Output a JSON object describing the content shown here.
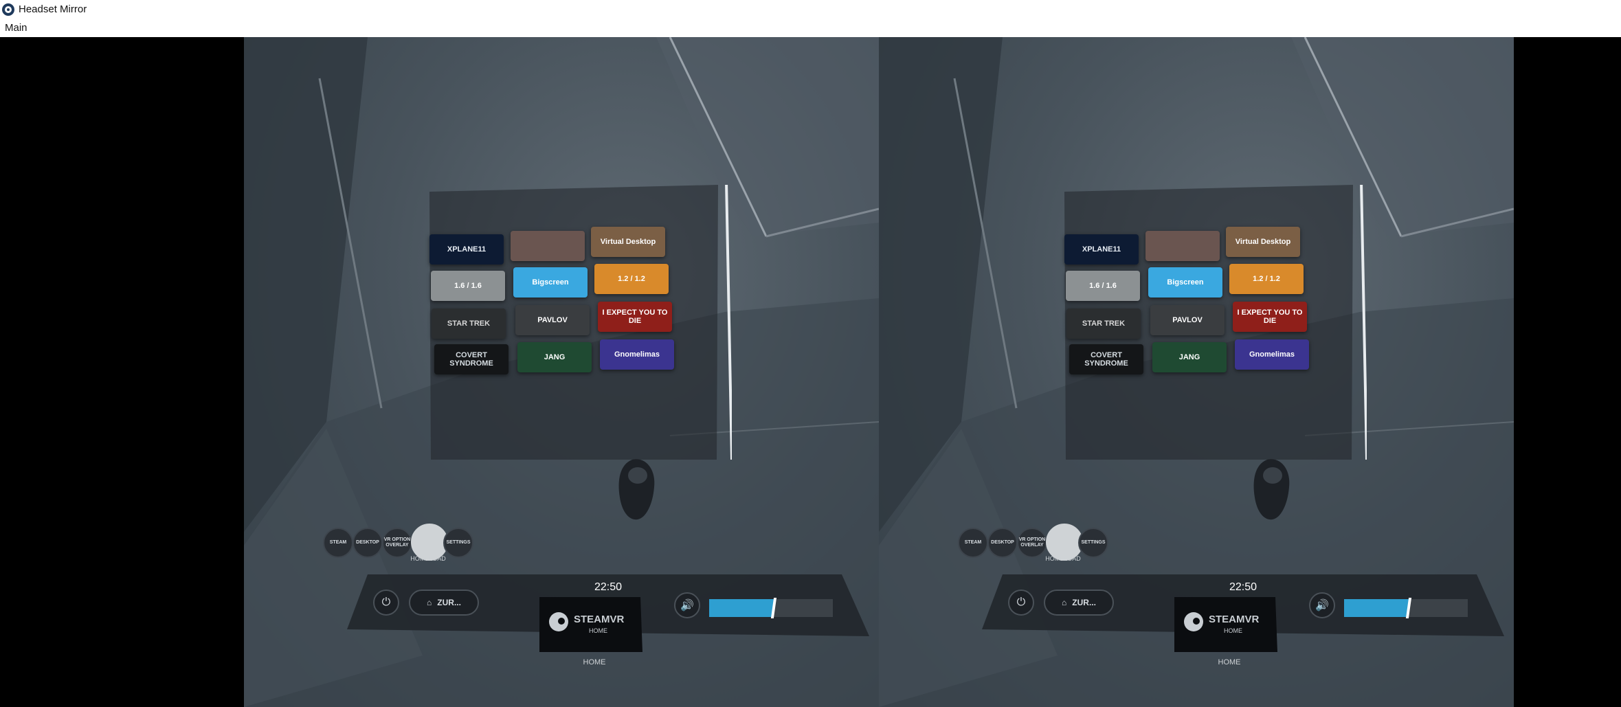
{
  "window": {
    "title": "Headset Mirror",
    "icon": "steamvr-icon"
  },
  "menu": {
    "items": [
      {
        "label": "Main"
      }
    ]
  },
  "vr_view": {
    "tiles": [
      {
        "label": "XPLANE11",
        "bg": "#0d1b33",
        "fg": "#e8eef5"
      },
      {
        "label": "",
        "bg": "#6a5550",
        "fg": "#ffffff"
      },
      {
        "label": "Virtual Desktop",
        "bg": "#7b5f45",
        "fg": "#ffffff"
      },
      {
        "label": "1.6 / 1.6",
        "bg": "#8c9193",
        "fg": "#ffffff"
      },
      {
        "label": "Bigscreen",
        "bg": "#3aa8e0",
        "fg": "#ffffff"
      },
      {
        "label": "1.2 / 1.2",
        "bg": "#d98a2b",
        "fg": "#ffffff"
      },
      {
        "label": "STAR TREK",
        "bg": "#2b2e30",
        "fg": "#d8d8d8"
      },
      {
        "label": "PAVLOV",
        "bg": "#3a3d40",
        "fg": "#ffffff"
      },
      {
        "label": "I EXPECT YOU TO DIE",
        "bg": "#8f1f1a",
        "fg": "#ffffff"
      },
      {
        "label": "COVERT SYNDROME",
        "bg": "#141618",
        "fg": "#d6dde2"
      },
      {
        "label": "JANG",
        "bg": "#1f4a32",
        "fg": "#ffffff"
      },
      {
        "label": "Gnomelimas",
        "bg": "#3b3490",
        "fg": "#ffffff"
      }
    ],
    "shortcut_buttons": [
      {
        "label": "STEAM",
        "active": false
      },
      {
        "label": "DESKTOP",
        "active": false
      },
      {
        "label": "VR OPTION OVERLAY",
        "active": false
      },
      {
        "label": "",
        "active": true,
        "caption": "HOMELOAD"
      },
      {
        "label": "SETTINGS",
        "active": false
      }
    ],
    "dashboard": {
      "time": "22:50",
      "zur_label": "ZUR...",
      "steam_title": "STEAMVR",
      "steam_sub": "HOME",
      "home_caption": "HOME",
      "volume_fraction": 0.52,
      "accent": "#2e9fd1"
    }
  }
}
